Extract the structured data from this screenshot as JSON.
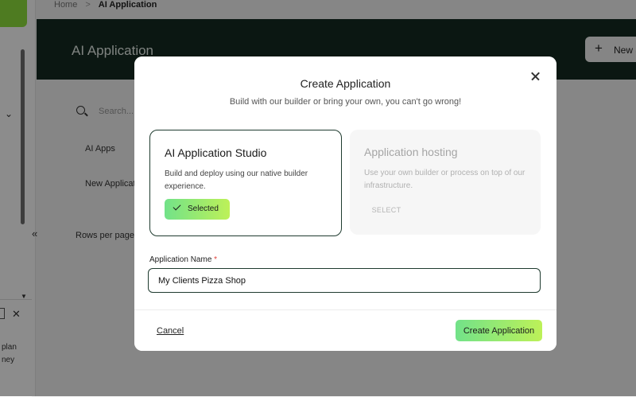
{
  "background": {
    "breadcrumb": {
      "home": "Home",
      "separator": ">",
      "current": "AI Application"
    },
    "header": {
      "title": "AI Application",
      "new_button_label": "New a"
    },
    "search": {
      "placeholder": "Search..."
    },
    "list": {
      "section_label": "AI Apps",
      "row_label": "New Applicat"
    },
    "pagination": {
      "rows_per_page_label": "Rows per page"
    },
    "side_panel": {
      "text_line_1": "plan",
      "text_line_2": "ney"
    }
  },
  "modal": {
    "title": "Create Application",
    "subtitle": "Build with our builder or bring your own, you can't go wrong!",
    "options": [
      {
        "title": "AI Application Studio",
        "description": "Build and deploy using our native builder experience.",
        "action_label": "Selected",
        "selected": true
      },
      {
        "title": "Application hosting",
        "description": "Use your own builder or process on top of our infrastructure.",
        "action_label": "SELECT",
        "selected": false
      }
    ],
    "field": {
      "label": "Application Name",
      "required_mark": "*",
      "value": "My Clients Pizza Shop"
    },
    "footer": {
      "cancel_label": "Cancel",
      "submit_label": "Create Application"
    }
  },
  "colors": {
    "header_bg": "#142a22",
    "accent_gradient_start": "#72e289",
    "accent_gradient_end": "#bdf158",
    "selected_border": "#1f3b2f",
    "required": "#e0413a"
  }
}
